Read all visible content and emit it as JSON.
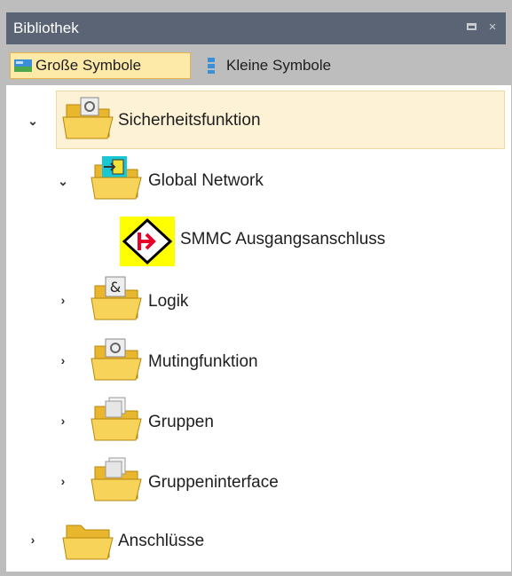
{
  "panel": {
    "title": "Bibliothek",
    "close_glyph": "×"
  },
  "toolbar": {
    "large_icons_label": "Große Symbole",
    "small_icons_label": "Kleine Symbole"
  },
  "tree": {
    "items": [
      {
        "label": "Sicherheitsfunktion",
        "expanded": true,
        "selected": true,
        "icon": "folder-gear-icon"
      },
      {
        "label": "Global Network",
        "expanded": true,
        "icon": "folder-network-icon"
      },
      {
        "label": "SMMC Ausgangsanschluss",
        "icon": "smmc-output-connector-icon"
      },
      {
        "label": "Logik",
        "expanded": false,
        "icon": "folder-logic-icon"
      },
      {
        "label": "Mutingfunktion",
        "expanded": false,
        "icon": "folder-gear-icon"
      },
      {
        "label": "Gruppen",
        "expanded": false,
        "icon": "folder-group-icon"
      },
      {
        "label": "Gruppeninterface",
        "expanded": false,
        "icon": "folder-group-icon"
      },
      {
        "label": "Anschlüsse",
        "expanded": false,
        "icon": "folder-icon"
      }
    ]
  },
  "colors": {
    "titlebar": "#5a6474",
    "selected_tool": "#fde9a8",
    "selected_row": "#fdf1d6",
    "folder": "#f4c842",
    "smmc_background": "#ffff00",
    "smmc_arrow": "#e8002a"
  }
}
